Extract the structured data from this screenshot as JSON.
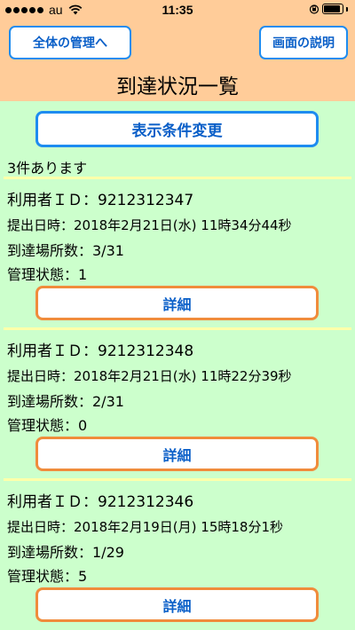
{
  "status_bar": {
    "carrier": "au",
    "time": "11:35",
    "battery_level": 0.9
  },
  "header": {
    "left_button": "全体の管理へ",
    "right_button": "画面の説明",
    "title": "到達状況一覧"
  },
  "main": {
    "filter_button": "表示条件変更",
    "count_text": "3件あります",
    "records": [
      {
        "user_id": "利用者ＩＤ：9212312347",
        "submitted": "提出日時：2018年2月21日(水) 11時34分44秒",
        "reached": "到達場所数：3/31",
        "status": "管理状態：1",
        "detail_label": "詳細"
      },
      {
        "user_id": "利用者ＩＤ：9212312348",
        "submitted": "提出日時：2018年2月21日(水) 11時22分39秒",
        "reached": "到達場所数：2/31",
        "status": "管理状態：0",
        "detail_label": "詳細"
      },
      {
        "user_id": "利用者ＩＤ：9212312346",
        "submitted": "提出日時：2018年2月19日(月) 15時18分1秒",
        "reached": "到達場所数：1/29",
        "status": "管理状態：5",
        "detail_label": "詳細"
      }
    ]
  },
  "colors": {
    "header_bg": "#ffcc99",
    "content_bg": "#ccffcc",
    "primary_button_border": "#1e8cf0",
    "detail_button_border": "#f08c3c",
    "button_text": "#0a5fc8",
    "separator": "#ffffaa"
  },
  "icons": {
    "signal": "signal-dots-icon",
    "wifi": "wifi-icon",
    "orientation_lock": "orientation-lock-icon",
    "battery": "battery-icon"
  }
}
